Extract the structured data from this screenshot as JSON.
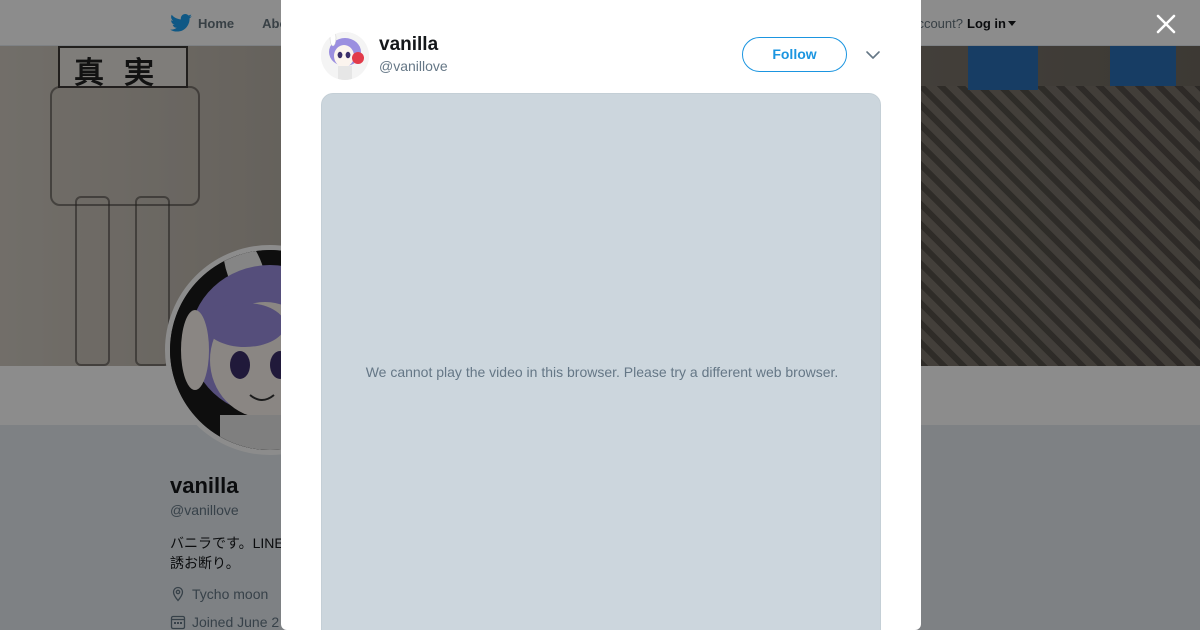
{
  "nav": {
    "home_label": "Home",
    "about_label": "Abo",
    "account_prompt": "ccount?",
    "login_label": "Log in"
  },
  "banner": {
    "sign_text": "真実"
  },
  "profile": {
    "name": "vanilla",
    "handle": "@vanillove",
    "bio": "バニラです。LINE\n誘お断り。",
    "location": "Tycho moon",
    "joined": "Joined June 2"
  },
  "modal": {
    "name": "vanilla",
    "handle": "@vanillove",
    "follow_label": "Follow",
    "video_message": "We cannot play the video in this browser. Please try a different web browser."
  },
  "colors": {
    "brand_blue": "#1b95e0",
    "video_bg": "#ccd6dd"
  },
  "icons": {
    "nav_home": "twitter-bird-icon",
    "close": "close-icon",
    "menu": "chevron-down-icon",
    "location": "location-pin-icon",
    "calendar": "calendar-icon"
  }
}
